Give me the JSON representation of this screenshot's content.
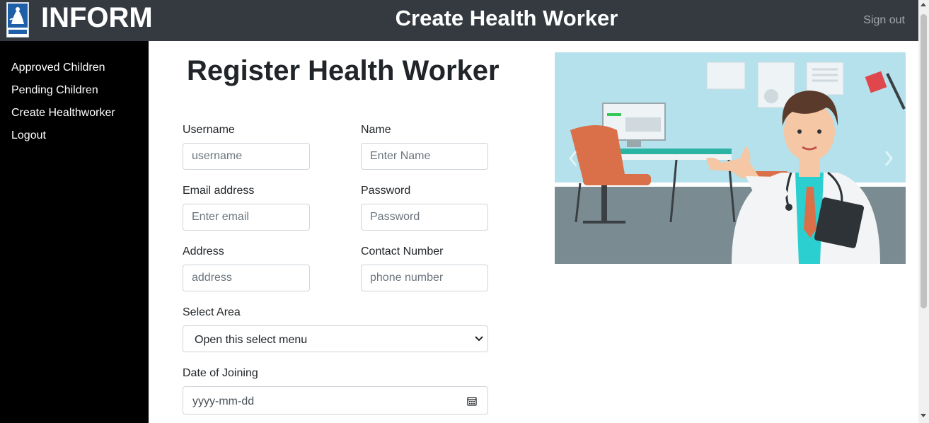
{
  "header": {
    "logo_icon": "inform-logo-icon",
    "brand": "INFORM",
    "page_title": "Create Health Worker",
    "sign_out": "Sign out",
    "background": "#343a40"
  },
  "sidebar": {
    "background": "#000000",
    "items": [
      {
        "label": "Approved Children"
      },
      {
        "label": "Pending Children"
      },
      {
        "label": "Create Healthworker"
      },
      {
        "label": "Logout"
      }
    ]
  },
  "form": {
    "title": "Register Health Worker",
    "username": {
      "label": "Username",
      "placeholder": "username"
    },
    "name": {
      "label": "Name",
      "placeholder": "Enter Name"
    },
    "email": {
      "label": "Email address",
      "placeholder": "Enter email"
    },
    "password": {
      "label": "Password",
      "placeholder": "Password"
    },
    "address": {
      "label": "Address",
      "placeholder": "address"
    },
    "contact": {
      "label": "Contact Number",
      "placeholder": "phone number"
    },
    "area": {
      "label": "Select Area",
      "selected": "Open this select menu"
    },
    "joining": {
      "label": "Date of Joining",
      "placeholder": "yyyy-mm-dd"
    }
  },
  "carousel": {
    "image": "doctor-illustration",
    "prev_icon": "chevron-left-icon",
    "next_icon": "chevron-right-icon"
  }
}
